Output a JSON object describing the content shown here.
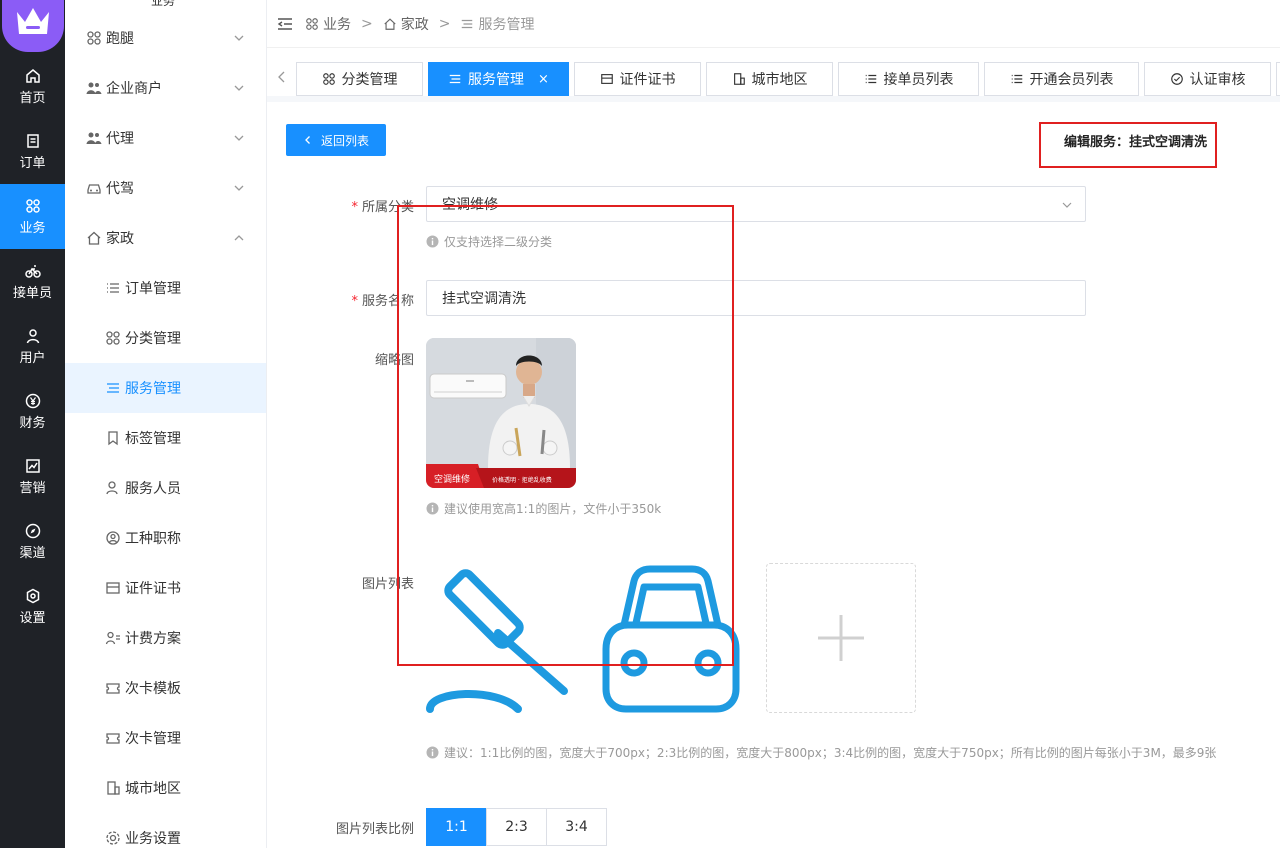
{
  "rail": {
    "items": [
      {
        "label": "首页",
        "icon": "home-icon"
      },
      {
        "label": "订单",
        "icon": "order-icon"
      },
      {
        "label": "业务",
        "icon": "grid-icon"
      },
      {
        "label": "接单员",
        "icon": "bike-icon"
      },
      {
        "label": "用户",
        "icon": "user-icon"
      },
      {
        "label": "财务",
        "icon": "yen-icon"
      },
      {
        "label": "营销",
        "icon": "chart-icon"
      },
      {
        "label": "渠道",
        "icon": "compass-icon"
      },
      {
        "label": "设置",
        "icon": "settings-icon"
      }
    ],
    "active_index": 2
  },
  "sidebar": {
    "cut_title": "业务",
    "items": [
      {
        "label": "跑腿",
        "level": "top",
        "icon": "grid-icon",
        "caret": "down"
      },
      {
        "label": "企业商户",
        "level": "top",
        "icon": "users-icon",
        "caret": "down"
      },
      {
        "label": "代理",
        "level": "top",
        "icon": "users-icon",
        "caret": "down"
      },
      {
        "label": "代驾",
        "level": "top",
        "icon": "car-icon",
        "caret": "down"
      },
      {
        "label": "家政",
        "level": "top",
        "icon": "house-icon",
        "caret": "up"
      },
      {
        "label": "订单管理",
        "level": "sub",
        "icon": "list-icon"
      },
      {
        "label": "分类管理",
        "level": "sub",
        "icon": "grid-icon"
      },
      {
        "label": "服务管理",
        "level": "sub",
        "icon": "menu-icon",
        "active": true
      },
      {
        "label": "标签管理",
        "level": "sub",
        "icon": "bookmark-icon"
      },
      {
        "label": "服务人员",
        "level": "sub",
        "icon": "person-icon"
      },
      {
        "label": "工种职称",
        "level": "sub",
        "icon": "badge-icon"
      },
      {
        "label": "证件证书",
        "level": "sub",
        "icon": "card-icon"
      },
      {
        "label": "计费方案",
        "level": "sub",
        "icon": "person-list-icon"
      },
      {
        "label": "次卡模板",
        "level": "sub",
        "icon": "ticket-icon"
      },
      {
        "label": "次卡管理",
        "level": "sub",
        "icon": "ticket-icon"
      },
      {
        "label": "城市地区",
        "level": "sub",
        "icon": "building-icon"
      },
      {
        "label": "业务设置",
        "level": "sub",
        "icon": "gear-icon"
      }
    ]
  },
  "breadcrumb": {
    "items": [
      "业务",
      "家政",
      "服务管理"
    ],
    "sep": ">"
  },
  "tabs": [
    {
      "label": "分类管理",
      "icon": "grid-icon"
    },
    {
      "label": "服务管理",
      "icon": "menu-icon",
      "active": true,
      "close": "×"
    },
    {
      "label": "证件证书",
      "icon": "card-icon"
    },
    {
      "label": "城市地区",
      "icon": "building-icon"
    },
    {
      "label": "接单员列表",
      "icon": "list-icon"
    },
    {
      "label": "开通会员列表",
      "icon": "list-icon"
    },
    {
      "label": "认证审核",
      "icon": "check-circle-icon"
    }
  ],
  "page": {
    "back_label": "返回列表",
    "edit_title": "编辑服务：挂式空调清洗"
  },
  "form": {
    "category": {
      "label": "所属分类",
      "value": "空调维修",
      "hint": "仅支持选择二级分类"
    },
    "name": {
      "label": "服务名称",
      "value": "挂式空调清洗"
    },
    "thumb": {
      "label": "缩略图",
      "banner_left": "空调维修",
      "banner_right": "价格透明 · 拒绝乱收费",
      "hint": "建议使用宽高1:1的图片，文件小于350k"
    },
    "gallery": {
      "label": "图片列表",
      "hint": "建议：1:1比例的图，宽度大于700px；2:3比例的图，宽度大于800px；3:4比例的图，宽度大于750px；所有比例的图片每张小于3M，最多9张"
    },
    "ratio": {
      "label": "图片列表比例",
      "options": [
        "1:1",
        "2:3",
        "3:4"
      ],
      "selected": "1:1"
    }
  },
  "colors": {
    "accent": "#1890ff",
    "rail_bg": "#1f2227",
    "annotation_red": "#e02020",
    "image_blue": "#1e9ae0"
  }
}
